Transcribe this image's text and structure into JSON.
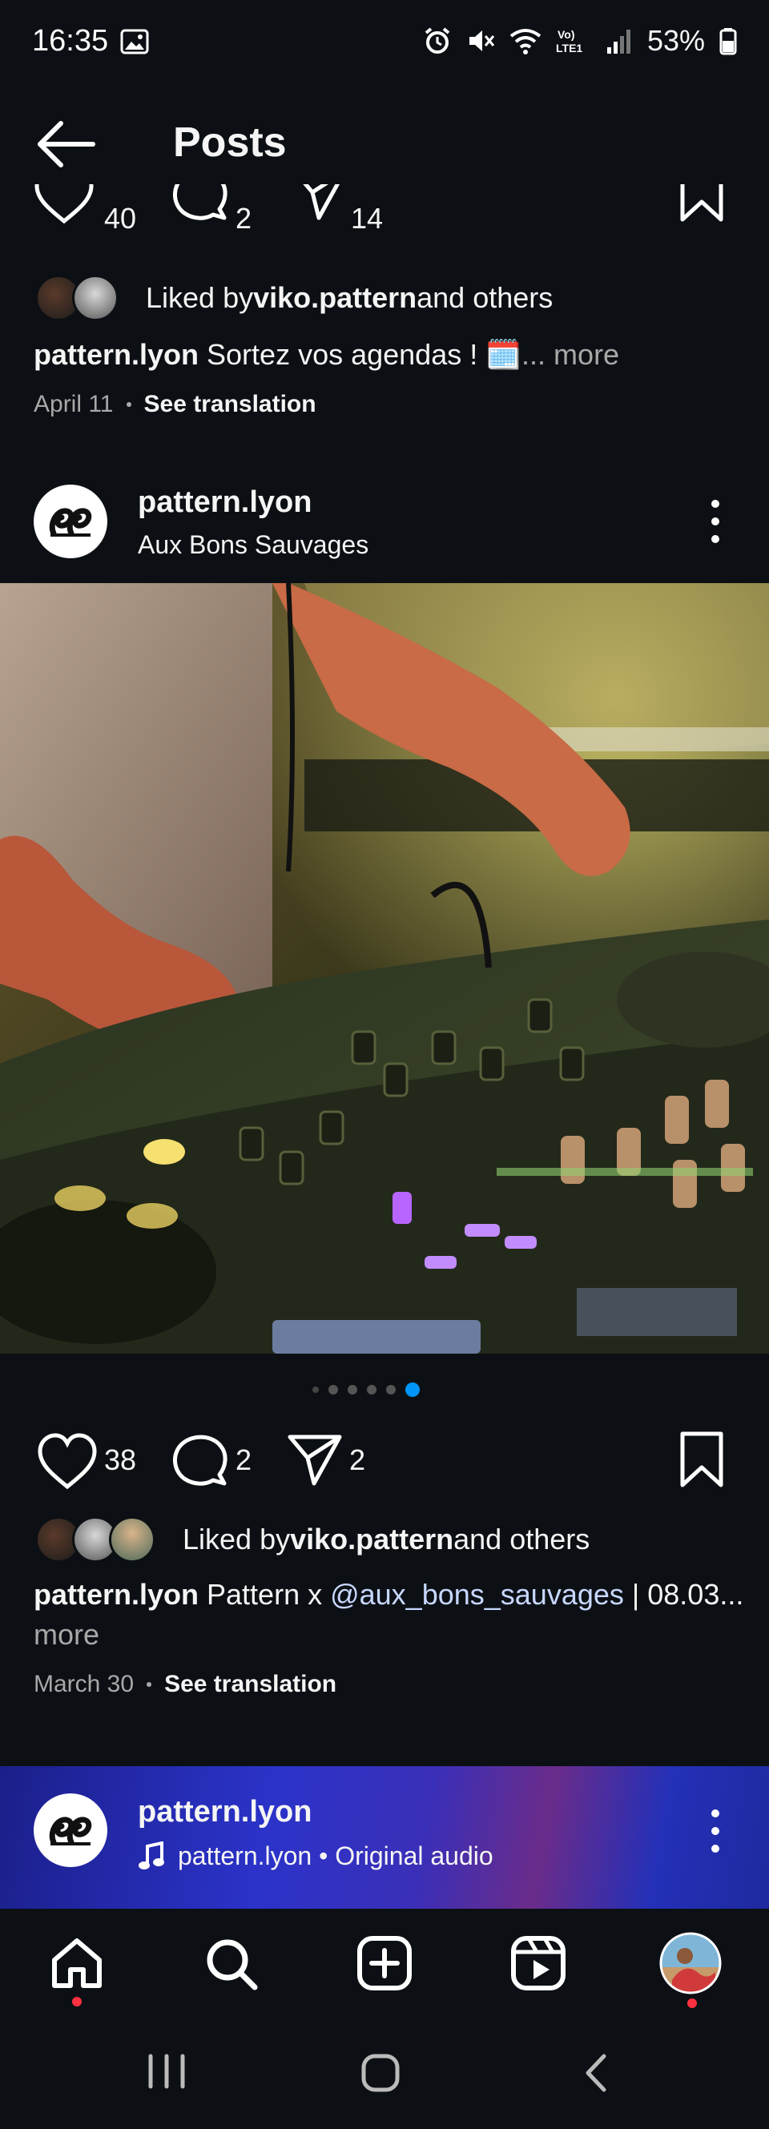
{
  "status_bar": {
    "time": "16:35",
    "battery": "53%"
  },
  "header": {
    "title": "Posts"
  },
  "post1": {
    "likes": "40",
    "comments": "2",
    "shares": "14",
    "liked_by_prefix": "Liked by ",
    "liked_by_user": "viko.pattern",
    "liked_by_suffix": " and others",
    "caption_user": "pattern.lyon",
    "caption_text": " Sortez vos agendas ! 🗓️",
    "caption_more": "... more",
    "date": "April 11",
    "see_translation": "See translation"
  },
  "post2": {
    "username": "pattern.lyon",
    "location": "Aux Bons Sauvages",
    "carousel_count": 6,
    "carousel_active": 6,
    "likes": "38",
    "comments": "2",
    "shares": "2",
    "liked_by_prefix": "Liked by ",
    "liked_by_user": "viko.pattern",
    "liked_by_suffix": " and others",
    "caption_user": "pattern.lyon",
    "caption_text": " Pattern x ",
    "caption_mention": "@aux_bons_sauvages",
    "caption_tail": " | 08.03...",
    "caption_more": "more",
    "date": "March 30",
    "see_translation": "See translation"
  },
  "post3": {
    "username": "pattern.lyon",
    "audio": "pattern.lyon • Original audio"
  },
  "icons": {
    "back": "arrow-left-icon",
    "like": "heart-icon",
    "comment": "comment-icon",
    "share": "send-icon",
    "save": "bookmark-icon",
    "more": "more-vertical-icon",
    "home": "home-icon",
    "search": "search-icon",
    "create": "plus-square-icon",
    "reels": "reels-icon",
    "profile": "profile-avatar"
  },
  "colors": {
    "background": "#0c1014",
    "accent": "#0095f6",
    "mention": "#c7d7ff",
    "notification": "#ff3040"
  }
}
